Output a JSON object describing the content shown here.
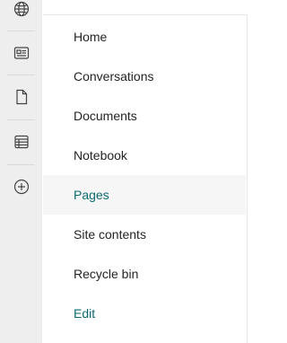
{
  "rail": {
    "items": [
      {
        "icon": "globe-icon"
      },
      {
        "icon": "news-icon"
      },
      {
        "icon": "page-icon"
      },
      {
        "icon": "list-icon"
      },
      {
        "icon": "add-circle-icon"
      }
    ]
  },
  "nav": {
    "items": [
      {
        "label": "Home"
      },
      {
        "label": "Conversations"
      },
      {
        "label": "Documents"
      },
      {
        "label": "Notebook"
      },
      {
        "label": "Pages",
        "selected": true
      },
      {
        "label": "Site contents"
      },
      {
        "label": "Recycle bin"
      }
    ],
    "edit_label": "Edit"
  },
  "colors": {
    "accent": "#0b6a6f",
    "rail_background": "#eeeeee",
    "selected_background": "#f6f6f6",
    "text": "#252423"
  }
}
